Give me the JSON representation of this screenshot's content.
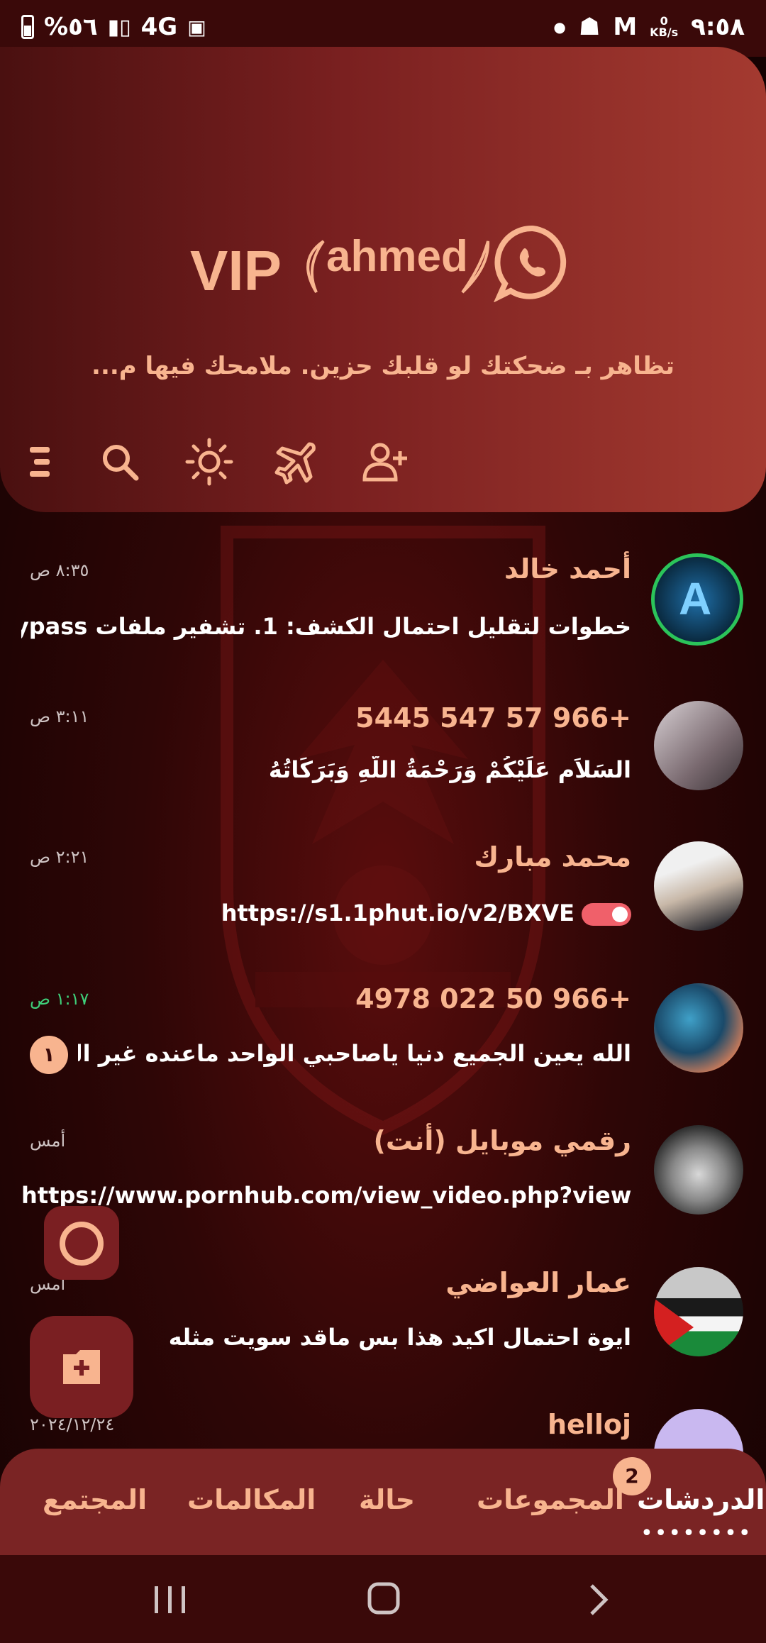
{
  "status_bar": {
    "battery_percent": "%٥٦",
    "network": "4G",
    "time": "٩:٥٨",
    "speed_value": "0",
    "speed_unit": "KB/s"
  },
  "header": {
    "brand_vip": "VIP",
    "brand_name": "ahmed",
    "tagline": "تظاهر بـ ضحكتك لو قلبك حزين. ملامحك فيها م..."
  },
  "toolbar": {
    "icons": [
      "menu-icon",
      "search-icon",
      "brightness-icon",
      "airplane-icon",
      "add-contact-icon"
    ]
  },
  "chats": [
    {
      "name": "أحمد خالد",
      "message": "خطوات لتقليل احتمال الكشف: 1. تشفير ملفات Bypass باستخ...",
      "time": "٨:٣٥ ص"
    },
    {
      "name": "+966 57 547 5445",
      "message": "السَلاَم عَلَيْكُمْ وَرَحْمَةُ اللَّهِ وَبَرَكَاتُهُ",
      "time": "٣:١١ ص"
    },
    {
      "name": "محمد مبارك",
      "message": "https://s1.1phut.io/v2/BXVE",
      "time": "٢:٢١ ص"
    },
    {
      "name": "+966 50 022 4978",
      "message": "الله يعين الجميع دنيا ياصاحبي الواحد ماعنده غير الصبر إح...",
      "time": "١:١٧ ص",
      "unread": "١"
    },
    {
      "name": "رقمي موبايل (أنت)",
      "message": "https://www.pornhub.com/view_video.php?view...",
      "time": "أمس"
    },
    {
      "name": "عمار العواضي",
      "message": "ايوة احتمال اكيد هذا بس ماقد سويت مثله",
      "time": "أمس"
    },
    {
      "name": "helloj",
      "message": "",
      "time": "٢٠٢٤/١٢/٢٤"
    }
  ],
  "bottom_nav": {
    "tabs": [
      "الدردشات",
      "المجموعات",
      "حالة",
      "المكالمات",
      "المجتمع"
    ],
    "chats_badge": "2"
  },
  "colors": {
    "accent": "#f8b48f",
    "header_start": "#4a1010",
    "header_end": "#a43a30",
    "nav_bg": "#7a2424",
    "green": "#3fd07a"
  }
}
